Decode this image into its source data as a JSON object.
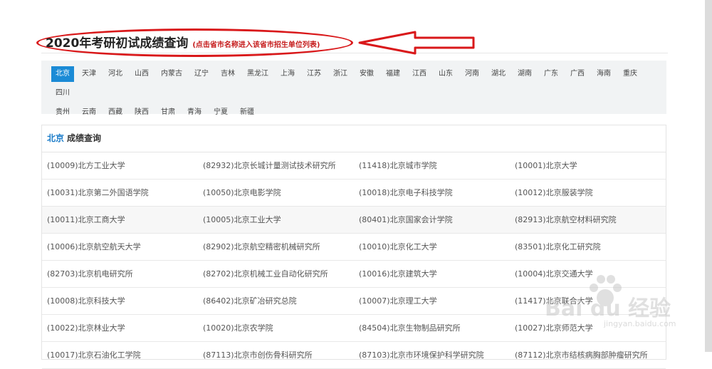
{
  "header": {
    "title": "2020年考研初试成绩查询",
    "hint": "(点击省市名称进入该省市招生单位列表)"
  },
  "provinces": {
    "items": [
      "北京",
      "天津",
      "河北",
      "山西",
      "内蒙古",
      "辽宁",
      "吉林",
      "黑龙江",
      "上海",
      "江苏",
      "浙江",
      "安徽",
      "福建",
      "江西",
      "山东",
      "河南",
      "湖北",
      "湖南",
      "广东",
      "广西",
      "海南",
      "重庆",
      "四川",
      "贵州",
      "云南",
      "西藏",
      "陕西",
      "甘肃",
      "青海",
      "宁夏",
      "新疆"
    ],
    "active": "北京"
  },
  "panel": {
    "city": "北京",
    "heading": "成绩查询",
    "rows": [
      [
        "(10009)北方工业大学",
        "(82932)北京长城计量测试技术研究所",
        "(11418)北京城市学院",
        "(10001)北京大学"
      ],
      [
        "(10031)北京第二外国语学院",
        "(10050)北京电影学院",
        "(10018)北京电子科技学院",
        "(10012)北京服装学院"
      ],
      [
        "(10011)北京工商大学",
        "(10005)北京工业大学",
        "(80401)北京国家会计学院",
        "(82913)北京航空材料研究院"
      ],
      [
        "(10006)北京航空航天大学",
        "(82902)北京航空精密机械研究所",
        "(10010)北京化工大学",
        "(83501)北京化工研究院"
      ],
      [
        "(82703)北京机电研究所",
        "(82702)北京机械工业自动化研究所",
        "(10016)北京建筑大学",
        "(10004)北京交通大学"
      ],
      [
        "(10008)北京科技大学",
        "(86402)北京矿冶研究总院",
        "(10007)北京理工大学",
        "(11417)北京联合大学"
      ],
      [
        "(10022)北京林业大学",
        "(10020)北京农学院",
        "(84504)北京生物制品研究所",
        "(10027)北京师范大学"
      ],
      [
        "(10017)北京石油化工学院",
        "(87113)北京市创伤骨科研究所",
        "(87103)北京市环境保护科学研究院",
        "(87112)北京市结核病胸部肿瘤研究所"
      ]
    ]
  },
  "watermark": {
    "brand": "Bai du 经验",
    "url": "jingyan.baidu.com"
  }
}
